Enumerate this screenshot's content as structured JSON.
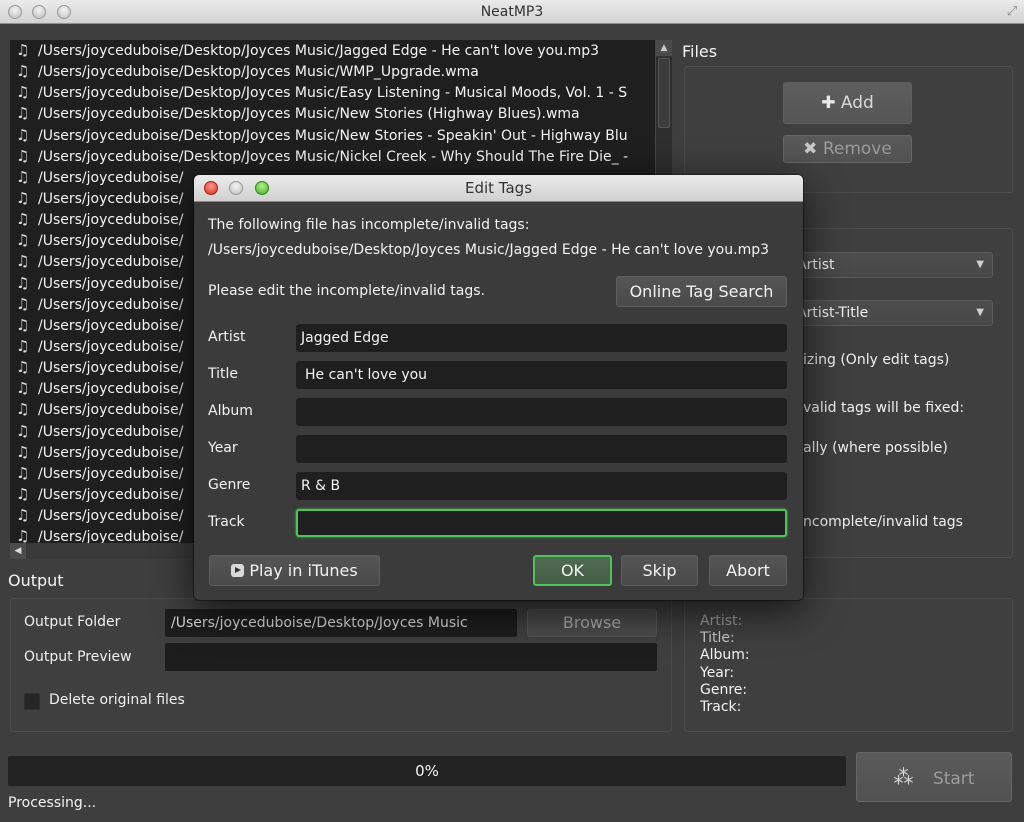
{
  "window": {
    "title": "NeatMP3"
  },
  "file_list": {
    "items": [
      "/Users/joyceduboise/Desktop/Joyces Music/Jagged Edge - He can't love you.mp3",
      "/Users/joyceduboise/Desktop/Joyces Music/WMP_Upgrade.wma",
      "/Users/joyceduboise/Desktop/Joyces Music/Easy Listening - Musical Moods, Vol. 1 - S",
      "/Users/joyceduboise/Desktop/Joyces Music/New Stories (Highway Blues).wma",
      "/Users/joyceduboise/Desktop/Joyces Music/New Stories - Speakin' Out - Highway Blu",
      "/Users/joyceduboise/Desktop/Joyces Music/Nickel Creek - Why Should The Fire Die_ -",
      "/Users/joyceduboise/",
      "/Users/joyceduboise/",
      "/Users/joyceduboise/",
      "/Users/joyceduboise/",
      "/Users/joyceduboise/",
      "/Users/joyceduboise/",
      "/Users/joyceduboise/",
      "/Users/joyceduboise/",
      "/Users/joyceduboise/",
      "/Users/joyceduboise/",
      "/Users/joyceduboise/",
      "/Users/joyceduboise/",
      "/Users/joyceduboise/",
      "/Users/joyceduboise/",
      "/Users/joyceduboise/",
      "/Users/joyceduboise/",
      "/Users/joyceduboise/",
      "/Users/joyceduboise/"
    ],
    "item_icon": "music-note-icon"
  },
  "files_panel": {
    "title": "Files",
    "add_label": "Add",
    "remove_label": "Remove"
  },
  "options_panel": {
    "select1_value": "Artist",
    "select2_value": "Artist-Title",
    "option1_text": "izing (Only edit tags)",
    "option2_text": "valid tags will be fixed:",
    "option3_text": "ally (where possible)",
    "option4_text": "ncomplete/invalid tags"
  },
  "output": {
    "title": "Output",
    "folder_label": "Output Folder",
    "folder_value": "/Users/joyceduboise/Desktop/Joyces Music",
    "browse_label": "Browse",
    "preview_label": "Output Preview",
    "preview_value": "",
    "delete_label": "Delete original files",
    "delete_checked": false
  },
  "tag_preview": {
    "lines": [
      "Artist:",
      "Title:",
      "Album:",
      "Year:",
      "Genre:",
      "Track:"
    ]
  },
  "progress": {
    "percent": 0,
    "percent_label": "0%",
    "status": "Processing...",
    "start_label": "Start"
  },
  "dialog": {
    "title": "Edit Tags",
    "intro": "The following file has incomplete/invalid tags:",
    "file_path": "/Users/joyceduboise/Desktop/Joyces Music/Jagged Edge - He can't love you.mp3",
    "instruction": "Please edit the incomplete/invalid tags.",
    "online_search_label": "Online Tag Search",
    "fields": [
      {
        "label": "Artist",
        "value": "Jagged Edge"
      },
      {
        "label": "Title",
        "value": "He can't love you"
      },
      {
        "label": "Album",
        "value": ""
      },
      {
        "label": "Year",
        "value": ""
      },
      {
        "label": "Genre",
        "value": "R & B"
      },
      {
        "label": "Track",
        "value": ""
      }
    ],
    "play_label": "Play in iTunes",
    "ok_label": "OK",
    "skip_label": "Skip",
    "abort_label": "Abort",
    "focus_color": "#4fc25a"
  }
}
